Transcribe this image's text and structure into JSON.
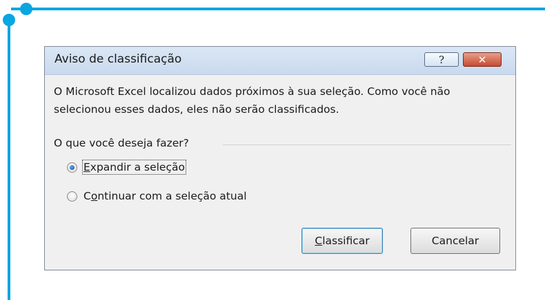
{
  "dialog": {
    "title": "Aviso de classificação",
    "help_glyph": "?",
    "close_glyph": "✕",
    "message": "O Microsoft Excel localizou dados próximos à sua seleção. Como você não selecionou esses dados, eles não serão classificados.",
    "question": "O que você deseja fazer?",
    "options": [
      {
        "access_key": "E",
        "label_rest": "xpandir a seleção",
        "selected": true
      },
      {
        "access_key_prefix": "C",
        "access_key": "o",
        "label_rest": "ntinuar com a seleção atual",
        "selected": false
      }
    ],
    "buttons": {
      "classify": {
        "access_key": "C",
        "label_rest": "lassificar"
      },
      "cancel": {
        "label": "Cancelar"
      }
    }
  },
  "colors": {
    "frame_accent": "#0aa6e2",
    "dialog_bg": "#f0f0f0",
    "close_button": "#c84a30"
  }
}
